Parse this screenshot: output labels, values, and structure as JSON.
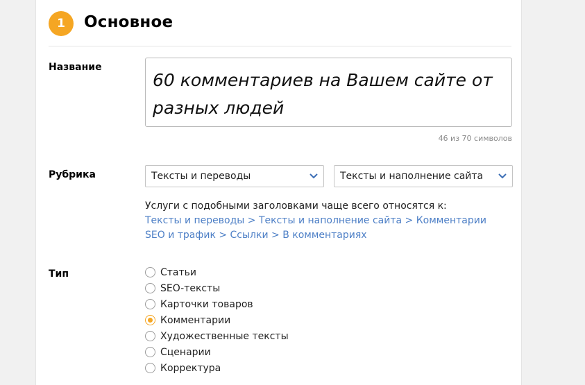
{
  "section": {
    "step_number": "1",
    "title": "Основное"
  },
  "name_field": {
    "label": "Название",
    "value": "60 комментариев на Вашем сайте от разных людей",
    "counter": "46 из 70 символов"
  },
  "category": {
    "label": "Рубрика",
    "primary_value": "Тексты и переводы",
    "secondary_value": "Тексты и наполнение сайта",
    "hint_text": "Услуги с подобными заголовками чаще всего относятся к:",
    "suggestions": [
      "Тексты и переводы > Тексты и наполнение сайта > Комментарии",
      "SEO и трафик > Ссылки > В комментариях"
    ]
  },
  "type": {
    "label": "Тип",
    "selected": "Комментарии",
    "options": [
      "Статьи",
      "SEO-тексты",
      "Карточки товаров",
      "Комментарии",
      "Художественные тексты",
      "Сценарии",
      "Корректура"
    ]
  },
  "colors": {
    "accent": "#f5a623",
    "link": "#4d7fc6",
    "chevron": "#3b6db5"
  }
}
